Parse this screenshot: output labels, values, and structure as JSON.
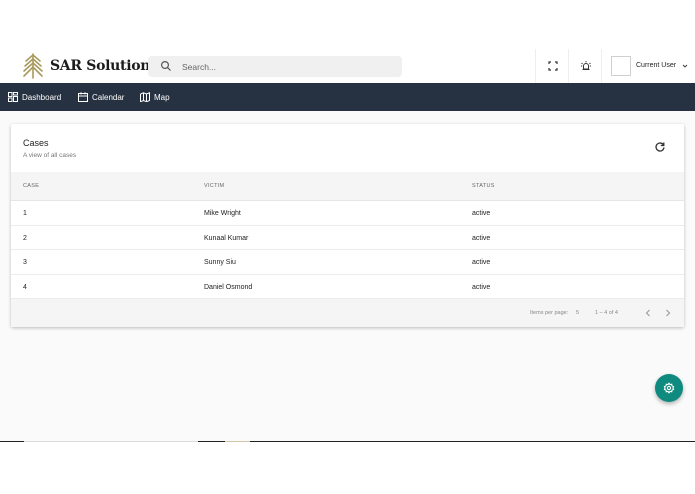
{
  "header": {
    "brand": "SAR Solutions",
    "search_placeholder": "Search...",
    "user_label": "Current User"
  },
  "nav": {
    "items": [
      {
        "label": "Dashboard",
        "icon": "dashboard-icon"
      },
      {
        "label": "Calendar",
        "icon": "calendar-icon"
      },
      {
        "label": "Map",
        "icon": "map-icon"
      }
    ]
  },
  "cases": {
    "title": "Cases",
    "subtitle": "A view of all cases",
    "columns": [
      "CASE",
      "VICTIM",
      "STATUS"
    ],
    "rows": [
      {
        "case": "1",
        "victim": "Mike Wright",
        "status": "active"
      },
      {
        "case": "2",
        "victim": "Kunaal Kumar",
        "status": "active"
      },
      {
        "case": "3",
        "victim": "Sunny Siu",
        "status": "active"
      },
      {
        "case": "4",
        "victim": "Daniel Osmond",
        "status": "active"
      }
    ],
    "footer": {
      "items_per_page_label": "Items per page:",
      "items_per_page_value": "5",
      "range": "1 – 4 of 4"
    }
  },
  "colors": {
    "navbar": "#263141",
    "fab": "#0f8a7e",
    "logo": "#a89a5e"
  },
  "icons": [
    "search-icon",
    "fullscreen-icon",
    "alarm-icon",
    "chevron-down-icon",
    "refresh-icon",
    "chevron-left-icon",
    "chevron-right-icon",
    "settings-icon"
  ]
}
